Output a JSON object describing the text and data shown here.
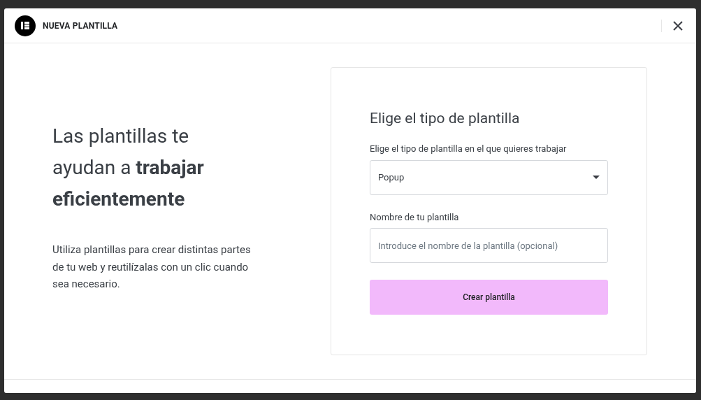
{
  "dialog": {
    "title": "NUEVA PLANTILLA"
  },
  "intro": {
    "heading": "Las plantillas te ayudan a **trabajar eficientemente**",
    "text": "Utiliza plantillas para crear distintas partes de tu web y reutilízalas con un clic cuando sea necesario."
  },
  "form": {
    "title": "Elige el tipo de plantilla",
    "type_field": {
      "label": "Elige el tipo de plantilla en el que quieres trabajar",
      "value": "Popup"
    },
    "name_field": {
      "label": "Nombre de tu plantilla",
      "placeholder": "Introduce el nombre de la plantilla (opcional)"
    },
    "submit": "Crear plantilla"
  }
}
